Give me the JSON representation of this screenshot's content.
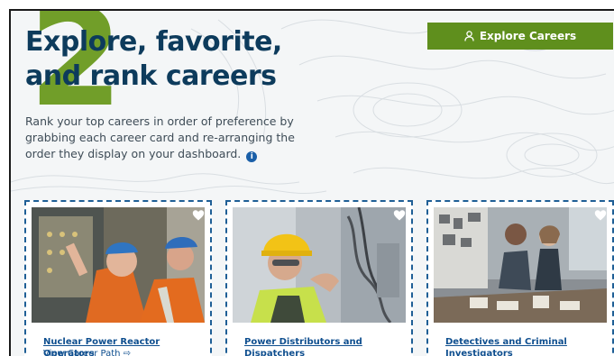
{
  "step_number": "2",
  "headline": "Explore, favorite, and rank careers",
  "intro": "Rank your top careers in order of preference by grabbing each career card and re-arranging the order they display on your dashboard.",
  "explore_button": {
    "label": "Explore Careers",
    "icon": "person-icon"
  },
  "colors": {
    "accent_green": "#5f8f1d",
    "headline_navy": "#0d3b5c",
    "link_blue": "#0f4f8f",
    "card_border": "#1f5f96"
  },
  "cards": [
    {
      "title": "Nuclear Power Reactor Operators",
      "link": "View Career Path ⇨",
      "favorite_icon": "heart-icon"
    },
    {
      "title": "Power Distributors and Dispatchers",
      "favorite_icon": "heart-icon"
    },
    {
      "title": "Detectives and Criminal Investigators",
      "favorite_icon": "heart-icon"
    }
  ]
}
